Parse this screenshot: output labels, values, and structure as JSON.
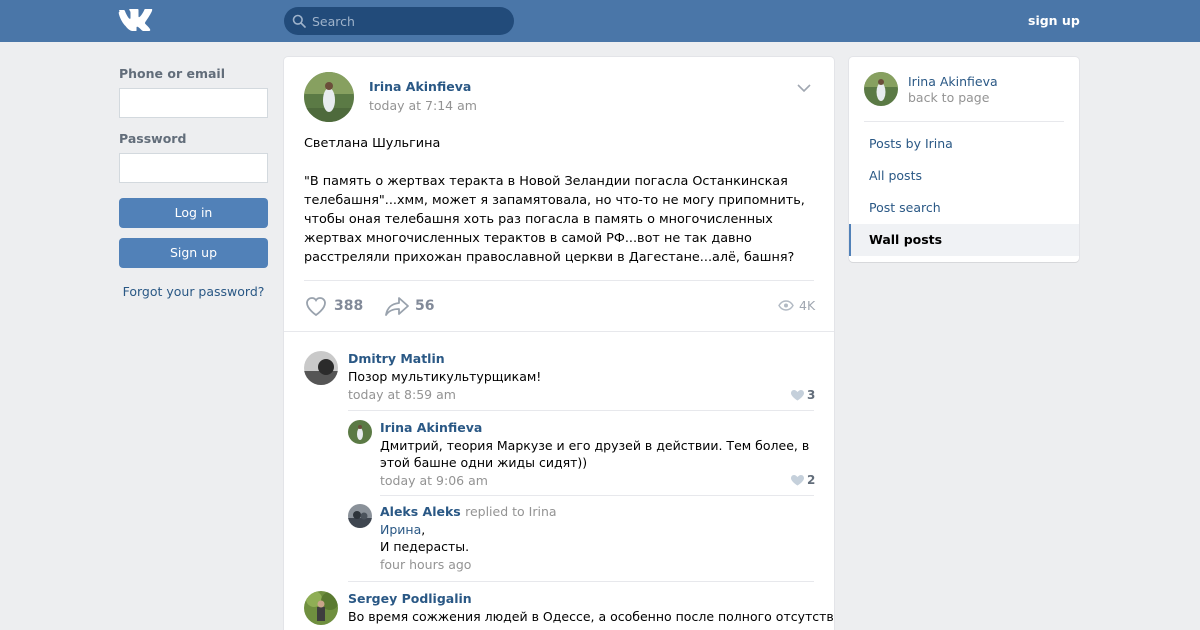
{
  "header": {
    "search_placeholder": "Search",
    "signup_label": "sign up"
  },
  "login": {
    "phone_label": "Phone or email",
    "password_label": "Password",
    "login_button": "Log in",
    "signup_button": "Sign up",
    "forgot_link": "Forgot your password?"
  },
  "post": {
    "author": "Irina Akinfieva",
    "time": "today at 7:14 am",
    "text_line1": "Светлана Шульгина",
    "text_body": "\"В память о жертвах теракта в Новой Зеландии погасла Останкинская телебашня\"...хмм, может я запамятовала, но что-то не могу припомнить, чтобы оная телебашня хоть раз погасла в память о многочисленных жертвах многочисленных терактов в самой РФ...вот не так давно расстреляли прихожан православной церкви в Дагестане...алё, башня?",
    "likes": "388",
    "shares": "56",
    "views": "4K"
  },
  "comments": [
    {
      "name": "Dmitry Matlin",
      "text": "Позор мультикультурщикам!",
      "time": "today at 8:59 am",
      "likes": "3"
    },
    {
      "name": "Irina Akinfieva",
      "text": "Дмитрий, теория Маркузе и его друзей в действии. Тем более, в этой башне одни жиды сидят))",
      "time": "today at 9:06 am",
      "likes": "2"
    },
    {
      "name": "Aleks Aleks",
      "replied": "replied to Irina",
      "mention": "Ирина",
      "text": "И педерасты.",
      "time": "four hours ago"
    },
    {
      "name": "Sergey Podligalin",
      "text": "Во время сожжения людей в Одессе, а особенно после полного отсутствия"
    }
  ],
  "sidebar": {
    "name": "Irina Akinfieva",
    "back": "back to page",
    "items": [
      {
        "label": "Posts by Irina"
      },
      {
        "label": "All posts"
      },
      {
        "label": "Post search"
      },
      {
        "label": "Wall posts"
      }
    ]
  },
  "colors": {
    "header": "#4a76a8",
    "link": "#2a5885",
    "button": "#5181b8",
    "background": "#edeef0"
  }
}
